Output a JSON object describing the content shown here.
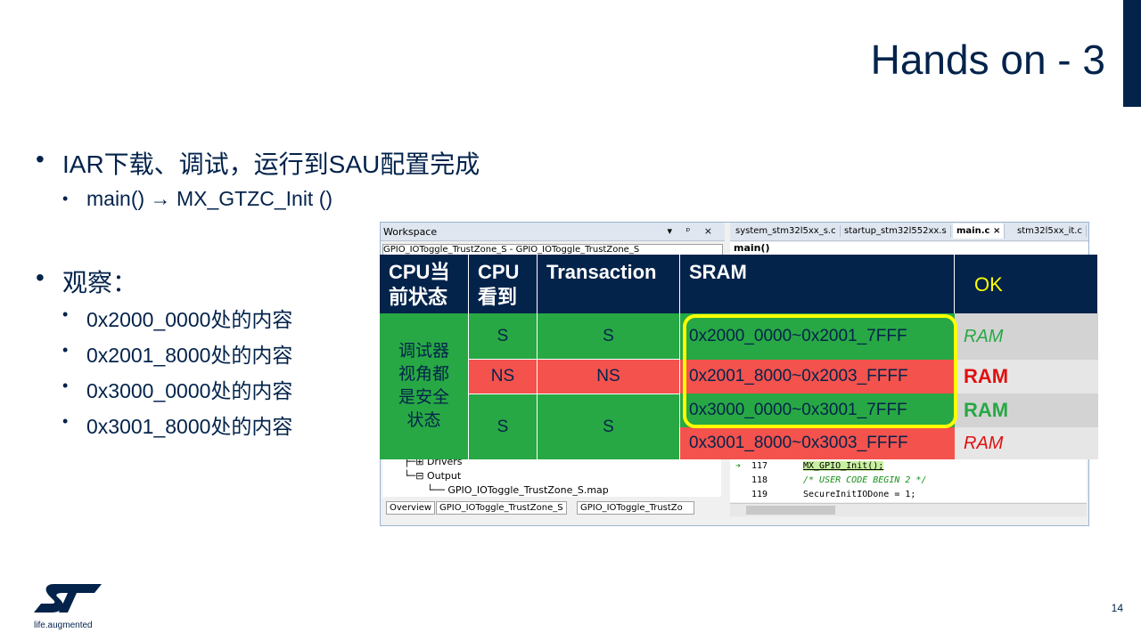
{
  "slide": {
    "title": "Hands on - 3",
    "page_number": "14",
    "logo_tagline": "life.augmented"
  },
  "bullets": {
    "b1": "IAR下载、调试，运行到SAU配置完成",
    "b1_sub": "main() → MX_GTZC_Init ()",
    "b2": "观察：",
    "b2_subs": [
      "0x2000_0000处的内容",
      "0x2001_8000处的内容",
      "0x3000_0000处的内容",
      "0x3001_8000处的内容"
    ]
  },
  "ide": {
    "workspace_title": "Workspace",
    "workspace_buttons": "▾ ᵖ ×",
    "workspace_combo": "GPIO_IOToggle_TrustZone_S - GPIO_IOToggle_TrustZone_S",
    "tabs": [
      "system_stm32l5xx_s.c",
      "startup_stm32l552xx.s",
      "main.c",
      "stm32l5xx_it.c"
    ],
    "tab_close": "×",
    "editor_func": "main()",
    "tree_items": [
      "├─⊞ Drivers",
      "└─⊟ Output",
      "└── GPIO_IOToggle_TrustZone_S.map"
    ],
    "bottom_tabs": [
      "Overview",
      "GPIO_IOToggle_TrustZone_S",
      "GPIO_IOToggle_TrustZo"
    ],
    "code_lines": [
      {
        "num": "117",
        "code": "MX_GPIO_Init();"
      },
      {
        "num": "118",
        "code": "/* USER CODE BEGIN 2 */"
      },
      {
        "num": "119",
        "code": "SecureInitIODone = 1;"
      }
    ]
  },
  "table": {
    "headers": {
      "state": "CPU当\n前状态",
      "cpu_sees": "CPU\n看到",
      "transaction": "Transaction",
      "sram": "SRAM",
      "ok": "OK"
    },
    "state_note": "调试器\n视角都\n是安全\n状态",
    "rows": [
      {
        "cpu": "S",
        "transaction": "S",
        "range": "0x2000_0000~0x2001_7FFF",
        "result": "RAM"
      },
      {
        "cpu": "NS",
        "transaction": "NS",
        "range": "0x2001_8000~0x2003_FFFF",
        "result": "RAM"
      },
      {
        "cpu": "S",
        "transaction": "S",
        "range": "0x3000_0000~0x3001_7FFF",
        "result": "RAM"
      },
      {
        "range": "0x3001_8000~0x3003_FFFF",
        "result": "RAM"
      }
    ],
    "colors": {
      "secure": "#27a844",
      "nonsecure": "#f4524d",
      "header": "#03234b",
      "highlight": "#ffff00"
    }
  }
}
